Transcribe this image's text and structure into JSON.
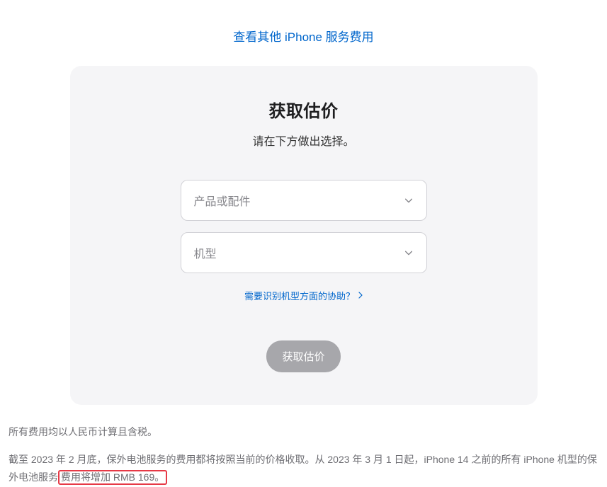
{
  "top_link": "查看其他 iPhone 服务费用",
  "card": {
    "title": "获取估价",
    "subtitle": "请在下方做出选择。",
    "select1_placeholder": "产品或配件",
    "select2_placeholder": "机型",
    "help_link": "需要识别机型方面的协助？",
    "button_label": "获取估价"
  },
  "footer": {
    "line1": "所有费用均以人民币计算且含税。",
    "line2_pre": "截至 2023 年 2 月底，保外电池服务的费用都将按照当前的价格收取。从 2023 年 3 月 1 日起，iPhone 14 之前的所有 iPhone 机型的保外电池服务",
    "line2_hl": "费用将增加 RMB 169。"
  }
}
